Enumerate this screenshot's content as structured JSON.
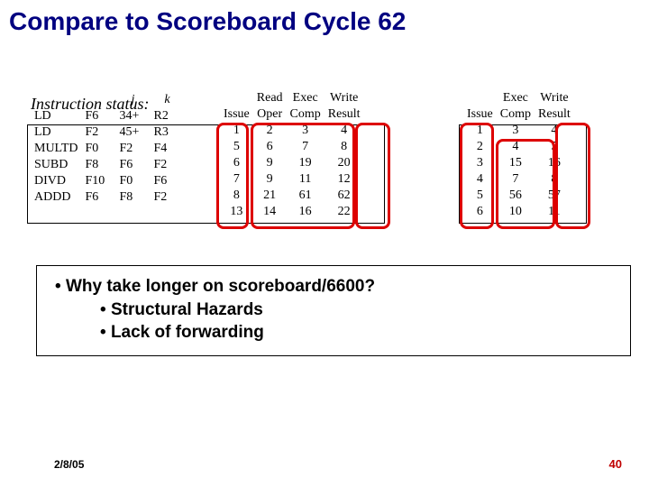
{
  "title": "Compare to Scoreboard Cycle 62",
  "status_heading": "Instruction status:",
  "columns": {
    "instr_headers": [
      "Instruction",
      "",
      "j",
      "k"
    ],
    "mid_headers_top": [
      "",
      "Read",
      "Exec",
      "Write"
    ],
    "mid_headers_bot": [
      "Issue",
      "Oper",
      "Comp",
      "Result"
    ],
    "right_headers_top": [
      "",
      "Exec",
      "Write"
    ],
    "right_headers_bot": [
      "Issue",
      "Comp",
      "Result"
    ]
  },
  "rows": [
    {
      "instr": "LD",
      "d": "F6",
      "j": "34+",
      "k": "R2",
      "mid": [
        "1",
        "2",
        "3",
        "4"
      ],
      "right": [
        "1",
        "3",
        "4"
      ]
    },
    {
      "instr": "LD",
      "d": "F2",
      "j": "45+",
      "k": "R3",
      "mid": [
        "5",
        "6",
        "7",
        "8"
      ],
      "right": [
        "2",
        "4",
        "5"
      ]
    },
    {
      "instr": "MULTD",
      "d": "F0",
      "j": "F2",
      "k": "F4",
      "mid": [
        "6",
        "9",
        "19",
        "20"
      ],
      "right": [
        "3",
        "15",
        "16"
      ]
    },
    {
      "instr": "SUBD",
      "d": "F8",
      "j": "F6",
      "k": "F2",
      "mid": [
        "7",
        "9",
        "11",
        "12"
      ],
      "right": [
        "4",
        "7",
        "8"
      ]
    },
    {
      "instr": "DIVD",
      "d": "F10",
      "j": "F0",
      "k": "F6",
      "mid": [
        "8",
        "21",
        "61",
        "62"
      ],
      "right": [
        "5",
        "56",
        "57"
      ]
    },
    {
      "instr": "ADDD",
      "d": "F6",
      "j": "F8",
      "k": "F2",
      "mid": [
        "13",
        "14",
        "16",
        "22"
      ],
      "right": [
        "6",
        "10",
        "11"
      ]
    }
  ],
  "bullets": {
    "q": "Why take longer on scoreboard/6600?",
    "a1": "Structural Hazards",
    "a2": "Lack of forwarding"
  },
  "footer": {
    "date": "2/8/05",
    "page": "40"
  }
}
